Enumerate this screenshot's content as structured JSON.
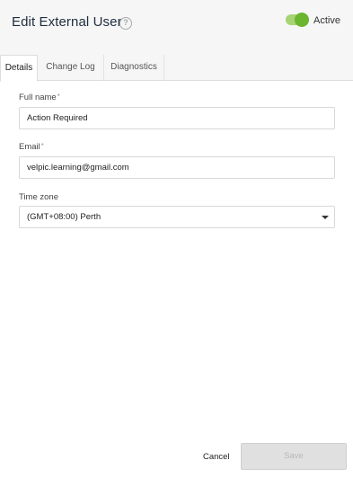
{
  "header": {
    "title": "Edit External User",
    "help_icon": "question-circle-icon",
    "active_label": "Active",
    "active_on": true,
    "toggle_color": "#6cb52f"
  },
  "tabs": [
    {
      "label": "Details",
      "active": true
    },
    {
      "label": "Change Log",
      "active": false
    },
    {
      "label": "Diagnostics",
      "active": false
    }
  ],
  "form": {
    "full_name": {
      "label": "Full name",
      "required_marker": "*",
      "value": "Action Required"
    },
    "email": {
      "label": "Email",
      "required_marker": "*",
      "value": "velpic.learning@gmail.com"
    },
    "time_zone": {
      "label": "Time zone",
      "value": "(GMT+08:00) Perth",
      "caret_icon": "caret-down-icon"
    }
  },
  "footer": {
    "cancel_label": "Cancel",
    "save_label": "Save",
    "save_disabled": true
  }
}
